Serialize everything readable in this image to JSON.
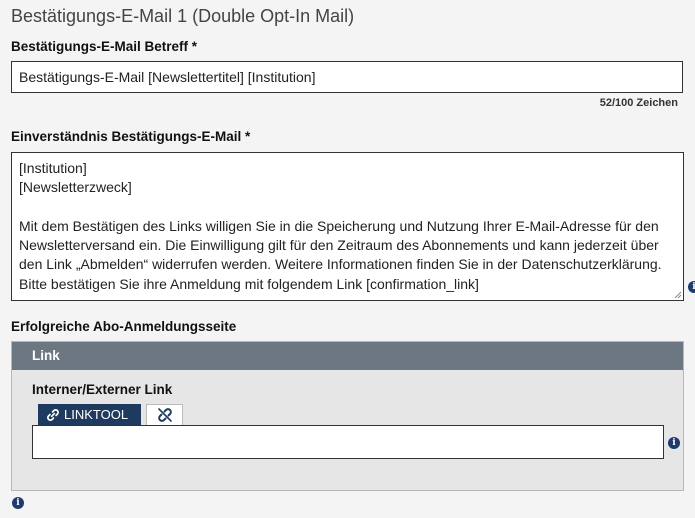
{
  "section": {
    "title": "Bestätigungs-E-Mail 1 (Double Opt-In Mail)"
  },
  "subject": {
    "label": "Bestätigungs-E-Mail Betreff *",
    "value": "Bestätigungs-E-Mail [Newslettertitel] [Institution]",
    "counter": "52/100 Zeichen"
  },
  "consent": {
    "label": "Einverständnis Bestätigungs-E-Mail *",
    "value": "[Institution]\n[Newsletterzweck]\n\nMit dem Bestätigen des Links willigen Sie in die Speicherung und Nutzung Ihrer E-Mail-Adresse für den Newsletterversand ein. Die Einwilligung gilt für den Zeitraum des Abonnements und kann jederzeit über den Link „Abmelden“ widerrufen werden. Weitere Informationen finden Sie in der Datenschutzerklärung. Bitte bestätigen Sie ihre Anmeldung mit folgendem Link [confirmation_link]"
  },
  "success_page": {
    "label": "Erfolgreiche Abo-Anmeldungsseite",
    "panel_header": "Link",
    "link_label": "Interner/Externer Link",
    "linktool_tab": "LINKTOOL",
    "link_value": ""
  },
  "icons": {
    "info": "info-icon",
    "link": "link-icon",
    "unlink": "unlink-icon",
    "info_glyph": "i"
  },
  "colors": {
    "panel_header": "#6d7781",
    "linktool_tab": "#1e3a5f",
    "info_icon": "#1e3a6e"
  }
}
